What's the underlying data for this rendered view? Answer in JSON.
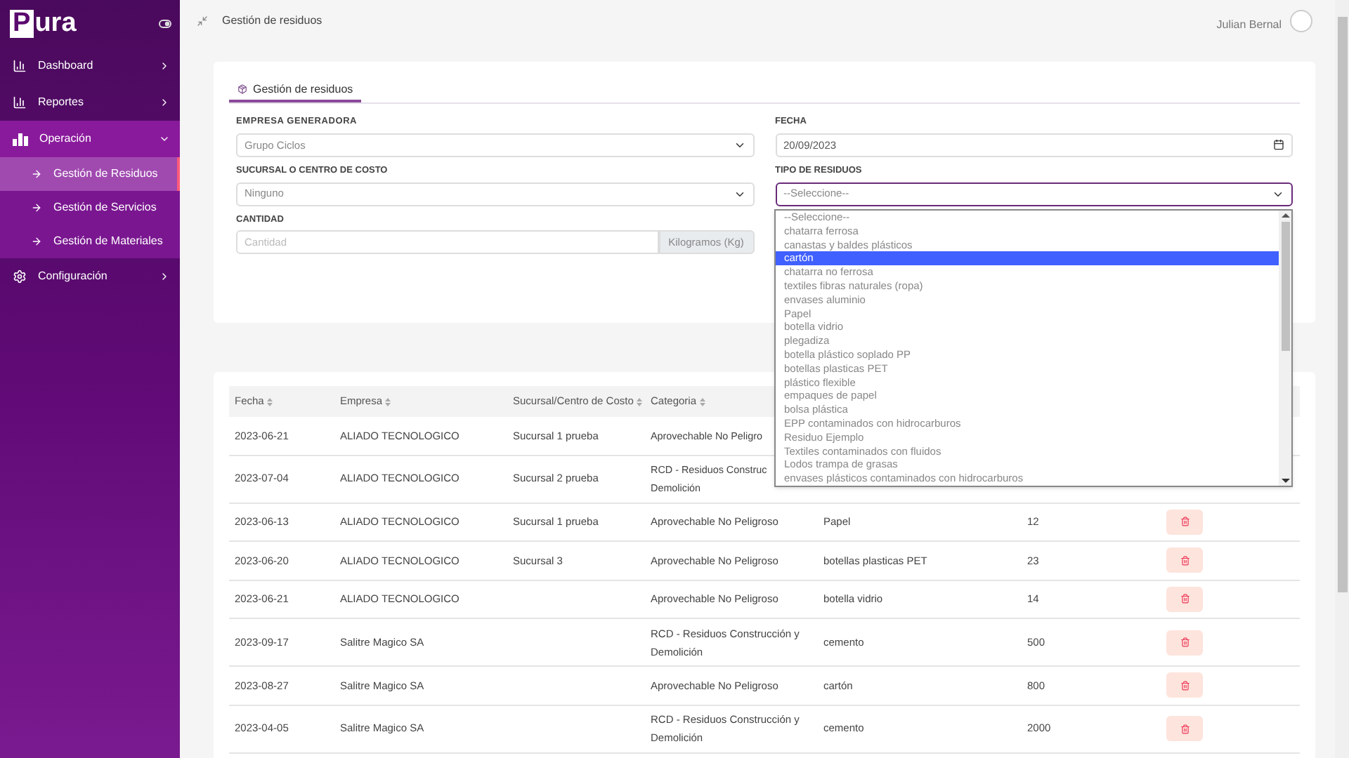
{
  "logo": {
    "boxed": "P",
    "rest": "ura"
  },
  "sidebar": {
    "items": [
      {
        "label": "Dashboard",
        "expanded": false,
        "selected": false
      },
      {
        "label": "Reportes",
        "expanded": false,
        "selected": false
      },
      {
        "label": "Operación",
        "expanded": true,
        "selected": true,
        "children": [
          {
            "label": "Gestión de Residuos",
            "selected": true
          },
          {
            "label": "Gestión de Servicios",
            "selected": false
          },
          {
            "label": "Gestión de Materiales",
            "selected": false
          }
        ]
      },
      {
        "label": "Configuración",
        "expanded": false,
        "selected": false
      }
    ]
  },
  "topbar": {
    "title": "Gestión de residuos",
    "user": "Julian Bernal"
  },
  "form": {
    "tab": {
      "label": "Gestión de residuos",
      "selected": true
    },
    "empresa": {
      "label": "EMPRESA GENERADORA",
      "value": "Grupo Ciclos"
    },
    "fecha": {
      "label": "FECHA",
      "value": "20/09/2023"
    },
    "sucursal": {
      "label": "SUCURSAL O CENTRO DE COSTO",
      "value": "Ninguno"
    },
    "tipo": {
      "label": "TIPO DE RESIDUOS",
      "value": "--Seleccione--",
      "expanded": true,
      "options": [
        {
          "label": "--Seleccione--",
          "highlighted": false
        },
        {
          "label": "chatarra ferrosa",
          "highlighted": false
        },
        {
          "label": "canastas y baldes plásticos",
          "highlighted": false
        },
        {
          "label": "cartón",
          "highlighted": true
        },
        {
          "label": "chatarra no ferrosa",
          "highlighted": false
        },
        {
          "label": "textiles fibras naturales (ropa)",
          "highlighted": false
        },
        {
          "label": "envases aluminio",
          "highlighted": false
        },
        {
          "label": "Papel",
          "highlighted": false
        },
        {
          "label": "botella vidrio",
          "highlighted": false
        },
        {
          "label": "plegadiza",
          "highlighted": false
        },
        {
          "label": "botella plástico soplado PP",
          "highlighted": false
        },
        {
          "label": "botellas plasticas PET",
          "highlighted": false
        },
        {
          "label": "plástico flexible",
          "highlighted": false
        },
        {
          "label": "empaques de papel",
          "highlighted": false
        },
        {
          "label": "bolsa plástica",
          "highlighted": false
        },
        {
          "label": "EPP contaminados con hidrocarburos",
          "highlighted": false
        },
        {
          "label": "Residuo Ejemplo",
          "highlighted": false
        },
        {
          "label": "Textiles contaminados con fluidos",
          "highlighted": false
        },
        {
          "label": "Lodos trampa de grasas",
          "highlighted": false
        },
        {
          "label": "envases plásticos contaminados con hidrocarburos",
          "highlighted": false
        }
      ]
    },
    "cantidad": {
      "label": "CANTIDAD",
      "placeholder": "Cantidad",
      "unit": "Kilogramos (Kg)"
    }
  },
  "table": {
    "columns": [
      "Fecha",
      "Empresa",
      "Sucursal/Centro de Costo",
      "Categoria"
    ],
    "rows": [
      {
        "fecha": "2023-06-21",
        "empresa": "ALIADO TECNOLOGICO",
        "sucursal": "Sucursal 1 prueba",
        "categoria": "Aprovechable No Peligro"
      },
      {
        "fecha": "2023-07-04",
        "empresa": "ALIADO TECNOLOGICO",
        "sucursal": "Sucursal 2 prueba",
        "categoria": "RCD - Residuos Construc Demolición"
      },
      {
        "fecha": "2023-06-13",
        "empresa": "ALIADO TECNOLOGICO",
        "sucursal": "Sucursal 1 prueba",
        "categoria": "Aprovechable No Peligroso",
        "residuo": "Papel",
        "cantidad": "12"
      },
      {
        "fecha": "2023-06-20",
        "empresa": "ALIADO TECNOLOGICO",
        "sucursal": "Sucursal 3",
        "categoria": "Aprovechable No Peligroso",
        "residuo": "botellas plasticas PET",
        "cantidad": "23"
      },
      {
        "fecha": "2023-06-21",
        "empresa": "ALIADO TECNOLOGICO",
        "categoria": "Aprovechable No Peligroso",
        "residuo": "botella vidrio",
        "cantidad": "14"
      },
      {
        "fecha": "2023-09-17",
        "empresa": "Salitre Magico SA",
        "categoria": "RCD - Residuos Construcción y Demolición",
        "residuo": "cemento",
        "cantidad": "500"
      },
      {
        "fecha": "2023-08-27",
        "empresa": "Salitre Magico SA",
        "categoria": "Aprovechable No Peligroso",
        "residuo": "cartón",
        "cantidad": "800"
      },
      {
        "fecha": "2023-04-05",
        "empresa": "Salitre Magico SA",
        "categoria": "RCD - Residuos Construcción y Demolición",
        "residuo": "cemento",
        "cantidad": "2000"
      }
    ]
  }
}
